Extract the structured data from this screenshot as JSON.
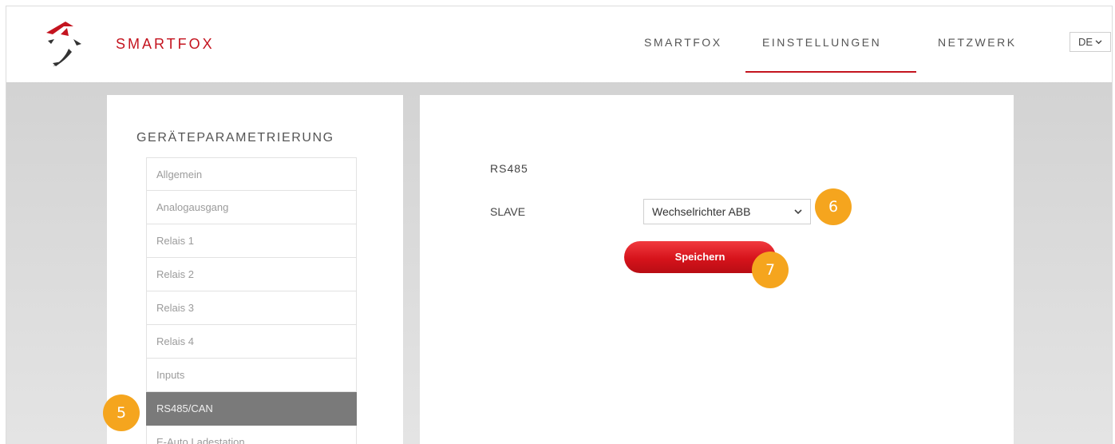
{
  "header": {
    "brand": "SMARTFOX",
    "nav": [
      {
        "label": "SMARTFOX"
      },
      {
        "label": "EINSTELLUNGEN",
        "active": true
      },
      {
        "label": "NETZWERK"
      }
    ],
    "language": "DE",
    "accent_color": "#c4141f"
  },
  "sidebar": {
    "title": "GERÄTEPARAMETRIERUNG",
    "items": [
      {
        "label": "Allgemein"
      },
      {
        "label": "Analogausgang"
      },
      {
        "label": "Relais 1"
      },
      {
        "label": "Relais 2"
      },
      {
        "label": "Relais 3"
      },
      {
        "label": "Relais 4"
      },
      {
        "label": "Inputs"
      },
      {
        "label": "RS485/CAN",
        "active": true
      },
      {
        "label": "E-Auto Ladestation"
      }
    ]
  },
  "main": {
    "section_title": "RS485",
    "slave_label": "SLAVE",
    "slave_value": "Wechselrichter ABB",
    "save_label": "Speichern"
  },
  "callouts": {
    "five": "5",
    "six": "6",
    "seven": "7",
    "color": "#f5a51e"
  }
}
